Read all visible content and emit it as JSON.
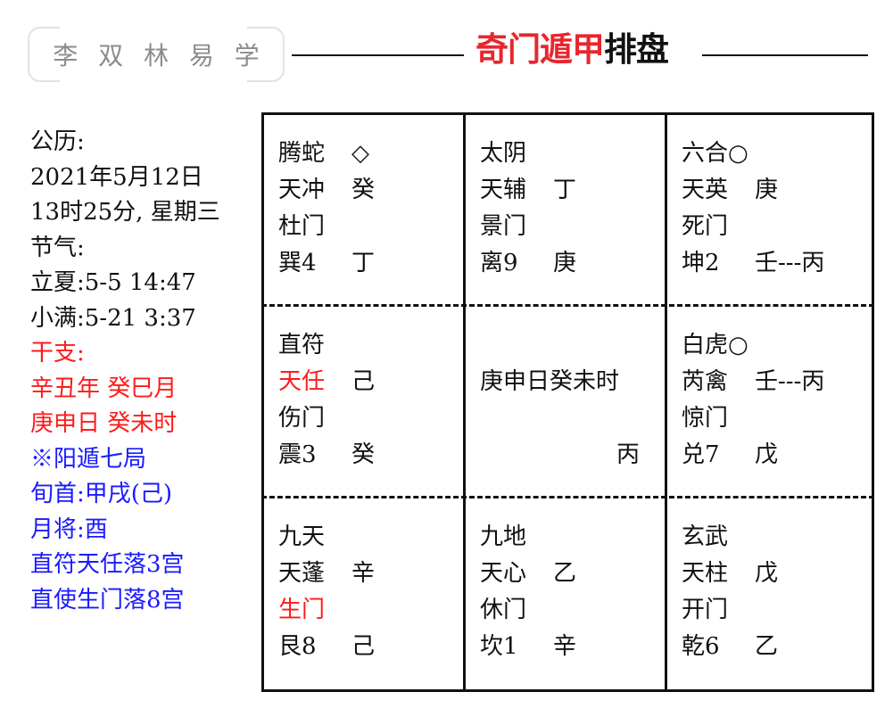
{
  "header": {
    "logo_text": "李 双 林 易 学",
    "title_red": "奇门遁甲",
    "title_black": "排盘"
  },
  "info": [
    {
      "text": "公历:",
      "color": "black"
    },
    {
      "text": "2021年5月12日",
      "color": "black"
    },
    {
      "text": "13时25分, 星期三",
      "color": "black"
    },
    {
      "text": "节气:",
      "color": "black"
    },
    {
      "text": "立夏:5-5  14:47",
      "color": "black"
    },
    {
      "text": "小满:5-21  3:37",
      "color": "black"
    },
    {
      "text": "干支:",
      "color": "red"
    },
    {
      "text": "辛丑年  癸巳月",
      "color": "red"
    },
    {
      "text": "庚申日  癸未时",
      "color": "red"
    },
    {
      "text": "※阳遁七局",
      "color": "blue"
    },
    {
      "text": "旬首:甲戌(己)",
      "color": "blue"
    },
    {
      "text": "月将:酉",
      "color": "blue"
    },
    {
      "text": "直符天任落3宫",
      "color": "blue"
    },
    {
      "text": "直使生门落8宫",
      "color": "blue"
    }
  ],
  "grid": {
    "cells": [
      {
        "position": "top-left",
        "palace": "巽4",
        "god": "腾蛇",
        "god_mark": "◇",
        "star": "天冲",
        "star_stem": "癸",
        "door": "杜门",
        "earth_stem": "丁",
        "star_red": false,
        "door_red": false
      },
      {
        "position": "top-middle",
        "palace": "离9",
        "god": "太阴",
        "god_mark": "",
        "star": "天辅",
        "star_stem": "丁",
        "door": "景门",
        "earth_stem": "庚",
        "star_red": false,
        "door_red": false
      },
      {
        "position": "top-right",
        "palace": "坤2",
        "god": "六合○",
        "god_mark": "",
        "star": "天英",
        "star_stem": "庚",
        "door": "死门",
        "earth_stem": "壬---丙",
        "star_red": false,
        "door_red": false
      },
      {
        "position": "middle-left",
        "palace": "震3",
        "god": "直符",
        "god_mark": "",
        "star": "天任",
        "star_stem": "己",
        "door": "伤门",
        "earth_stem": "癸",
        "star_red": true,
        "door_red": false
      },
      {
        "position": "center",
        "palace": "",
        "god": "",
        "god_mark": "",
        "star": "庚申日癸未时",
        "star_stem": "",
        "door": "",
        "earth_stem": "丙",
        "star_red": false,
        "door_red": false,
        "is_center": true
      },
      {
        "position": "middle-right",
        "palace": "兑7",
        "god": "白虎○",
        "god_mark": "",
        "star": "芮禽",
        "star_stem": "壬---丙",
        "door": "惊门",
        "earth_stem": "戊",
        "star_red": false,
        "door_red": false
      },
      {
        "position": "bottom-left",
        "palace": "艮8",
        "god": "九天",
        "god_mark": "",
        "star": "天蓬",
        "star_stem": "辛",
        "door": "生门",
        "earth_stem": "己",
        "star_red": false,
        "door_red": true
      },
      {
        "position": "bottom-middle",
        "palace": "坎1",
        "god": "九地",
        "god_mark": "",
        "star": "天心",
        "star_stem": "乙",
        "door": "休门",
        "earth_stem": "辛",
        "star_red": false,
        "door_red": false
      },
      {
        "position": "bottom-right",
        "palace": "乾6",
        "god": "玄武",
        "god_mark": "",
        "star": "天柱",
        "star_stem": "戊",
        "door": "开门",
        "earth_stem": "乙",
        "star_red": false,
        "door_red": false
      }
    ]
  },
  "colors": {
    "red": "#ff1a1a",
    "blue": "#1a1aff",
    "title_red": "#e8262c",
    "black": "#111111",
    "logo_gray": "#8c8c8c"
  }
}
